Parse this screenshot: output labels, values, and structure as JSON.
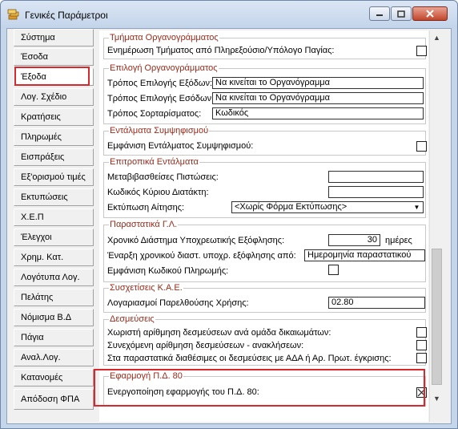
{
  "window": {
    "title": "Γενικές Παράμετροι"
  },
  "nav": {
    "items": [
      {
        "label": "Σύστημα"
      },
      {
        "label": "Έσοδα"
      },
      {
        "label": "Έξοδα"
      },
      {
        "label": "Λογ. Σχέδιο"
      },
      {
        "label": "Κρατήσεις"
      },
      {
        "label": "Πληρωμές"
      },
      {
        "label": "Εισπράξεις"
      },
      {
        "label": "Εξ'ορισμού τιμές"
      },
      {
        "label": "Εκτυπώσεις"
      },
      {
        "label": "Χ.Ε.Π"
      },
      {
        "label": "Έλεγχοι"
      },
      {
        "label": "Χρημ. Κατ."
      },
      {
        "label": "Λογότυπα Λογ."
      },
      {
        "label": "Πελάτης"
      },
      {
        "label": "Νόμισμα Β.Δ"
      },
      {
        "label": "Πάγια"
      },
      {
        "label": "Αναλ.Λογ."
      },
      {
        "label": "Κατανομές"
      },
      {
        "label": "Απόδοση ΦΠΑ"
      }
    ],
    "selected": "Έξοδα"
  },
  "groups": {
    "tmimata": {
      "title": "Τμήματα Οργανογράμματος",
      "row1_label": "Ενημέρωση Τμήματος από Πληρεξούσιο/Υπόλογο Παγίας:"
    },
    "epilogi": {
      "title": "Επιλογή Οργανογράμματος",
      "row1_label": "Τρόπος Επιλογής Εξόδων:",
      "row1_value": "Να κινείται το Οργανόγραμμα",
      "row2_label": "Τρόπος Επιλογής Εσόδων:",
      "row2_value": "Να κινείται το Οργανόγραμμα",
      "row3_label": "Τρόπος Σορταρίσματος:",
      "row3_value": "Κωδικός"
    },
    "entalmata": {
      "title": "Εντάλματα Συμψηφισμού",
      "row1_label": "Εμφάνιση Εντάλματος Συμψηφισμού:"
    },
    "epitropika": {
      "title": "Επιτροπικά Εντάλματα",
      "row1_label": "Μεταβιβασθείσες Πιστώσεις:",
      "row1_value": "",
      "row2_label": "Κωδικός Κύριου Διατάκτη:",
      "row2_value": "",
      "row3_label": "Εκτύπωση Αίτησης:",
      "row3_value": "<Χωρίς Φόρμα Εκτύπωσης>"
    },
    "parastatika": {
      "title": "Παραστατικά Γ.Λ.",
      "row1_label": "Χρονικό Διάστημα Υποχρεωτικής Εξόφλησης:",
      "row1_value": "30",
      "row1_unit": "ημέρες",
      "row2_label": "Έναρξη χρονικού διαστ. υποχρ. εξόφλησης από:",
      "row2_value": "Ημερομηνία παραστατικού",
      "row3_label": "Εμφάνιση Κωδικού Πληρωμής:"
    },
    "sysxetiseis": {
      "title": "Συσχετίσεις Κ.Α.Ε.",
      "row1_label": "Λογαριασμοί Παρελθούσης Χρήσης:",
      "row1_value": "02.80"
    },
    "desmeuseis": {
      "title": "Δεσμεύσεις",
      "row1_label": "Χωριστή αρίθμηση δεσμεύσεων ανά ομάδα δικαιωμάτων:",
      "row2_label": "Συνεχόμενη αρίθμηση δεσμεύσεων - ανακλήσεων:",
      "row3_label": "Στα παραστατικά διαθέσιμες οι δεσμεύσεις με ΑΔΑ ή Αρ. Πρωτ. έγκρισης:"
    },
    "efarmogi": {
      "title": "Εφαρμογή Π.Δ. 80",
      "row1_label": "Ενεργοποίηση εφαρμογής του Π.Δ. 80:",
      "row1_checked": true
    }
  }
}
